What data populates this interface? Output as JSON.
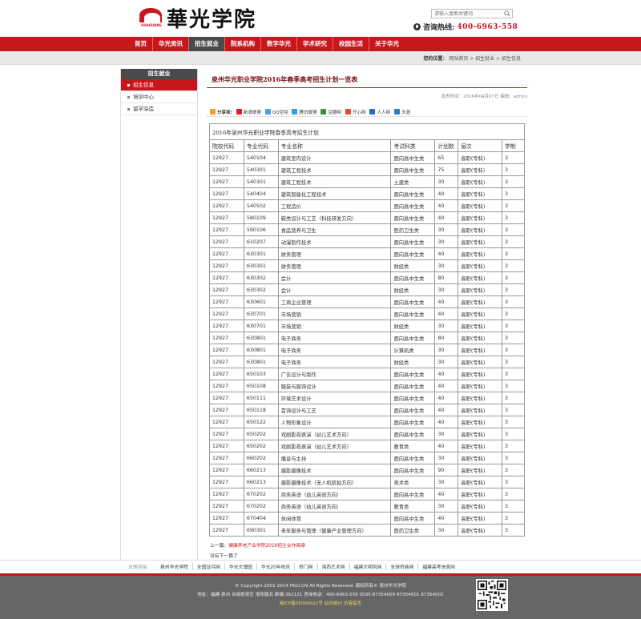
{
  "header": {
    "logo_mark_text": "HUAGUANG",
    "logo_name": "華光学院",
    "search_placeholder": "请输入搜索关键词",
    "hotline_label": "咨询热线:",
    "hotline_number": "400-6963-558"
  },
  "nav": {
    "items": [
      "首页",
      "华光资讯",
      "招生就业",
      "院系机构",
      "数字华光",
      "学术研究",
      "校园生活",
      "关于华光"
    ],
    "active": "招生就业"
  },
  "breadcrumb": {
    "label": "您的位置：",
    "path": "网站首页 > 招生就业 > 招生信息"
  },
  "sidebar": {
    "title": "招生就业",
    "items": [
      "招生信息",
      "培训中心",
      "留学深造"
    ],
    "active": "招生信息"
  },
  "article": {
    "title": "泉州华光职业学院2016年春季高考招生计划一览表",
    "meta": "发表时间：2016年04月07日  编辑：admin",
    "share_label": "分享到:",
    "share_items": [
      "新浪微博",
      "QQ空间",
      "腾讯微博",
      "豆瓣网",
      "开心网",
      "人人网",
      "天涯"
    ],
    "table_caption": "2016年泉州华光职业学院春季高考招生计划",
    "columns": [
      "院校代码",
      "专业代码",
      "专业名称",
      "考试科类",
      "计划数",
      "层次",
      "学制"
    ],
    "rows": [
      [
        "12927",
        "540104",
        "建筑室内设计",
        "面向高中生类",
        "65",
        "高职(专科)",
        "3"
      ],
      [
        "12927",
        "540301",
        "建筑工程技术",
        "面向高中生类",
        "75",
        "高职(专科)",
        "3"
      ],
      [
        "12927",
        "540301",
        "建筑工程技术",
        "土建类",
        "30",
        "高职(专科)",
        "3"
      ],
      [
        "12927",
        "540404",
        "建筑智能化工程技术",
        "面向高中生类",
        "40",
        "高职(专科)",
        "3"
      ],
      [
        "12927",
        "540502",
        "工程造价",
        "面向高中生类",
        "40",
        "高职(专科)",
        "3"
      ],
      [
        "12927",
        "580109",
        "鞋类设计与工艺（科技研发方向）",
        "面向高中生类",
        "40",
        "高职(专科)",
        "3"
      ],
      [
        "12927",
        "590106",
        "食品营养与卫生",
        "医药卫生类",
        "30",
        "高职(专科)",
        "3"
      ],
      [
        "12927",
        "610207",
        "动漫制作技术",
        "面向高中生类",
        "30",
        "高职(专科)",
        "3"
      ],
      [
        "12927",
        "630301",
        "财务管理",
        "面向高中生类",
        "40",
        "高职(专科)",
        "3"
      ],
      [
        "12927",
        "630301",
        "财务管理",
        "财经类",
        "30",
        "高职(专科)",
        "3"
      ],
      [
        "12927",
        "630302",
        "会计",
        "面向高中生类",
        "80",
        "高职(专科)",
        "3"
      ],
      [
        "12927",
        "630302",
        "会计",
        "财经类",
        "30",
        "高职(专科)",
        "3"
      ],
      [
        "12927",
        "630601",
        "工商企业管理",
        "面向高中生类",
        "40",
        "高职(专科)",
        "3"
      ],
      [
        "12927",
        "630701",
        "市场营销",
        "面向高中生类",
        "40",
        "高职(专科)",
        "3"
      ],
      [
        "12927",
        "630701",
        "市场营销",
        "财经类",
        "30",
        "高职(专科)",
        "3"
      ],
      [
        "12927",
        "630801",
        "电子商务",
        "面向高中生类",
        "80",
        "高职(专科)",
        "3"
      ],
      [
        "12927",
        "630801",
        "电子商务",
        "计算机类",
        "30",
        "高职(专科)",
        "3"
      ],
      [
        "12927",
        "630801",
        "电子商务",
        "财经类",
        "30",
        "高职(专科)",
        "3"
      ],
      [
        "12927",
        "650103",
        "广告设计与制作",
        "面向高中生类",
        "40",
        "高职(专科)",
        "3"
      ],
      [
        "12927",
        "650108",
        "服装与服饰设计",
        "面向高中生类",
        "40",
        "高职(专科)",
        "3"
      ],
      [
        "12927",
        "650111",
        "环境艺术设计",
        "面向高中生类",
        "40",
        "高职(专科)",
        "3"
      ],
      [
        "12927",
        "650118",
        "首饰设计与工艺",
        "面向高中生类",
        "40",
        "高职(专科)",
        "3"
      ],
      [
        "12927",
        "650122",
        "人物形象设计",
        "面向高中生类",
        "40",
        "高职(专科)",
        "3"
      ],
      [
        "12927",
        "650202",
        "戏剧影视表演（幼儿艺术方向）",
        "面向高中生类",
        "30",
        "高职(专科)",
        "3"
      ],
      [
        "12927",
        "650202",
        "戏剧影视表演（幼儿艺术方向）",
        "教育类",
        "40",
        "高职(专科)",
        "3"
      ],
      [
        "12927",
        "660202",
        "播音与主持",
        "面向高中生类",
        "30",
        "高职(专科)",
        "3"
      ],
      [
        "12927",
        "660213",
        "摄影摄像技术",
        "面向高中生类",
        "90",
        "高职(专科)",
        "3"
      ],
      [
        "12927",
        "660213",
        "摄影摄像技术（无人机航拍方向）",
        "美术类",
        "30",
        "高职(专科)",
        "3"
      ],
      [
        "12927",
        "670202",
        "商务英语（幼儿英语方向）",
        "面向高中生类",
        "40",
        "高职(专科)",
        "3"
      ],
      [
        "12927",
        "670202",
        "商务英语（幼儿英语方向）",
        "教育类",
        "30",
        "高职(专科)",
        "3"
      ],
      [
        "12927",
        "670404",
        "休闲体育",
        "面向高中生类",
        "40",
        "高职(专科)",
        "3"
      ],
      [
        "12927",
        "690301",
        "老年服务与管理（健康产业管理方向）",
        "医药卫生类",
        "30",
        "高职(专科)",
        "3"
      ]
    ],
    "prev_label": "上一篇：",
    "prev_link": "健康养老产业学院2016招生合作简章",
    "next_label": "没有下一篇了"
  },
  "friend_links": {
    "label": "友情链接：",
    "items": [
      "泉州华光学院",
      "全国证兵网",
      "华光文博园",
      "华光20年校庆",
      "侨门网",
      "海西艺术网",
      "福建文明风网",
      "全球侨商网",
      "福建高考信息网"
    ]
  },
  "footer": {
    "copyright": "© Copyright 2001-2014 HGU.CN All Rights Reserved.  版权所有© 泉州华光学院",
    "address": "地址：福建·泉州 台商投资区 洛阳镇北   邮编:362121   咨询电话：400-6963-558   0595-87354000  87354001  87354002",
    "icp": "闽ICP备05000022号 站长统计 访客留言"
  },
  "colors": {
    "brand_red": "#c8161d",
    "nav_active": "#4a4a4a",
    "footer_bg": "#666666",
    "link_red": "#c8161d"
  }
}
